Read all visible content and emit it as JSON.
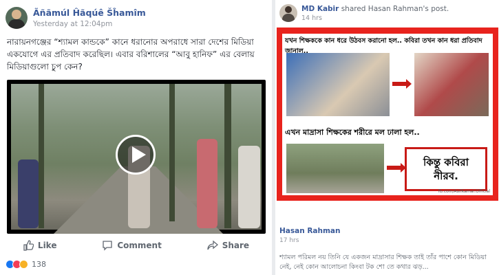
{
  "left_post": {
    "author": "Ãñãmúl Ĥãqúê Šĥamîm",
    "timestamp": "Yesterday at 12:04pm",
    "text": "নারায়নগঞ্জের “শ্যামল কান্ডকে” কানে ধরানোর অপরাধে সারা দেশের মিডিয়া একযোগে এর প্রতিবাদ করেছিল। এবার বরিশালের “আবু হানিফ” এর বেলায় মিডিয়াগুলো চুপ কেন?",
    "actions": {
      "like": "Like",
      "comment": "Comment",
      "share": "Share"
    },
    "reaction_count": "138",
    "reaction_colors": [
      "#1877f2",
      "#f33e58",
      "#f7b125"
    ]
  },
  "right_post": {
    "author": "MD Kabir",
    "shared_text": "shared Hasan Rahman's post.",
    "timestamp": "14 hrs",
    "poster": {
      "caption_top": "যখন শিক্ষককে কান ধরে উঠবস করানো হল.. কবিরা তখন কান ধরা প্রতিবাদ জানাল..",
      "caption_middle": "এখন মাদ্রাসা শিক্ষকের শরীরে মল ঢালা হল..",
      "nirab_line1": "কিন্তু কবিরা",
      "nirab_line2": "নীরব.",
      "credit": "fb.com/AsifKamal.Official"
    },
    "original_author": "Hasan Rahman",
    "original_time": "17 hrs",
    "original_text": "শ্যামল পরিমল নয় তিনি যে একজন মাদ্রাসার শিক্ষক তাই তাঁর পাশে কোন মিডিয়া নেই, নেই কোন আলোচনা কিংবা টক শো তে কথার ঝড়..."
  }
}
